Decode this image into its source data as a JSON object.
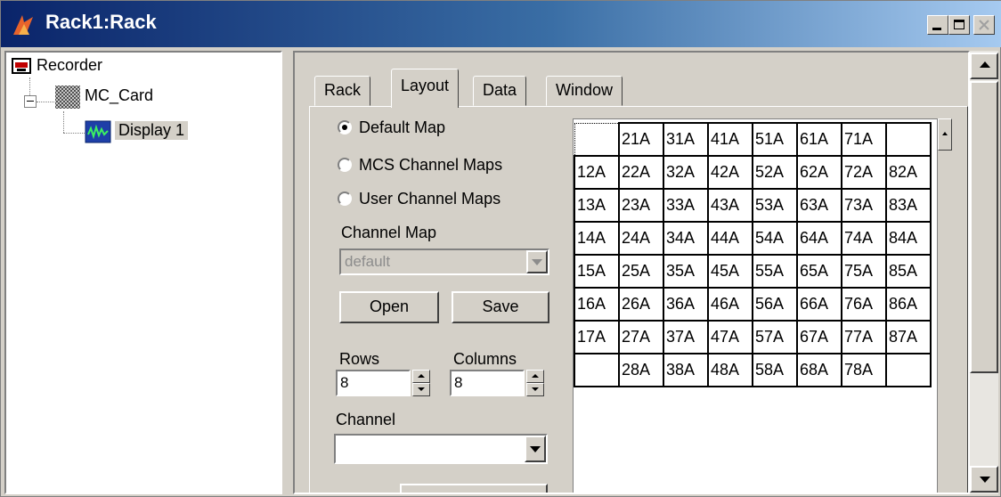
{
  "window": {
    "title": "Rack1:Rack",
    "icon": "app-icon",
    "controls": {
      "minimize": "_",
      "maximize": "□",
      "close": "×"
    }
  },
  "tree": {
    "items": [
      {
        "label": "Recorder",
        "icon": "recorder-icon"
      },
      {
        "label": "MC_Card",
        "icon": "card-icon"
      },
      {
        "label": "Display 1",
        "icon": "display-icon",
        "selected": true
      }
    ]
  },
  "tabs": [
    {
      "label": "Rack",
      "active": false
    },
    {
      "label": "Layout",
      "active": true
    },
    {
      "label": "Data",
      "active": false
    },
    {
      "label": "Window",
      "active": false
    }
  ],
  "layout": {
    "radios": [
      {
        "label": "Default Map",
        "checked": true
      },
      {
        "label": "MCS Channel Maps",
        "checked": false
      },
      {
        "label": "User Channel Maps",
        "checked": false
      }
    ],
    "channel_map_label": "Channel Map",
    "channel_map_value": "default",
    "open_label": "Open",
    "save_label": "Save",
    "rows_label": "Rows",
    "rows_value": "8",
    "columns_label": "Columns",
    "columns_value": "8",
    "channel_label": "Channel",
    "channel_value": ""
  },
  "grid": {
    "rows": [
      [
        "",
        "21A",
        "31A",
        "41A",
        "51A",
        "61A",
        "71A",
        ""
      ],
      [
        "12A",
        "22A",
        "32A",
        "42A",
        "52A",
        "62A",
        "72A",
        "82A"
      ],
      [
        "13A",
        "23A",
        "33A",
        "43A",
        "53A",
        "63A",
        "73A",
        "83A"
      ],
      [
        "14A",
        "24A",
        "34A",
        "44A",
        "54A",
        "64A",
        "74A",
        "84A"
      ],
      [
        "15A",
        "25A",
        "35A",
        "45A",
        "55A",
        "65A",
        "75A",
        "85A"
      ],
      [
        "16A",
        "26A",
        "36A",
        "46A",
        "56A",
        "66A",
        "76A",
        "86A"
      ],
      [
        "17A",
        "27A",
        "37A",
        "47A",
        "57A",
        "67A",
        "77A",
        "87A"
      ],
      [
        "",
        "28A",
        "38A",
        "48A",
        "58A",
        "68A",
        "78A",
        ""
      ]
    ]
  },
  "colors": {
    "titlebar_start": "#0a246a",
    "titlebar_end": "#a6caf0",
    "face": "#d4d0c8"
  }
}
